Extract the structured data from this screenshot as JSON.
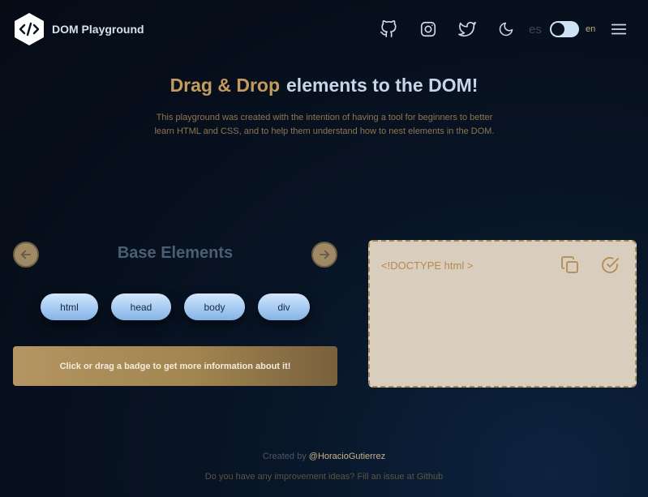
{
  "header": {
    "app_title": "DOM Playground",
    "icons": [
      "github-icon",
      "instagram-icon",
      "twitter-icon",
      "moon-icon",
      "menu-icon"
    ],
    "lang_es": "es",
    "lang_en": "en",
    "theme_toggle_on": false
  },
  "hero": {
    "title_accent": "Drag & Drop",
    "title_rest": "elements to the DOM!",
    "description": "This playground was created with the intention of having a tool for beginners to better learn HTML and CSS, and to help them understand how to nest elements in the DOM."
  },
  "elements_panel": {
    "title": "Base Elements",
    "badges": [
      "html",
      "head",
      "body",
      "div"
    ],
    "info": "Click or drag a badge to get more information about it!"
  },
  "dropzone": {
    "doctype": "<!DOCTYPE html  >"
  },
  "footer": {
    "credit_prefix": "Created by",
    "author": "@HoracioGutierrez",
    "ideas": "Do you have any improvement ideas? Fill an issue at Github"
  },
  "colors": {
    "accent_gold": "#c49a5f",
    "badge_blue": "#a9cdf3",
    "dropzone_bg": "#d9cdbd",
    "background": "#070f1c"
  }
}
